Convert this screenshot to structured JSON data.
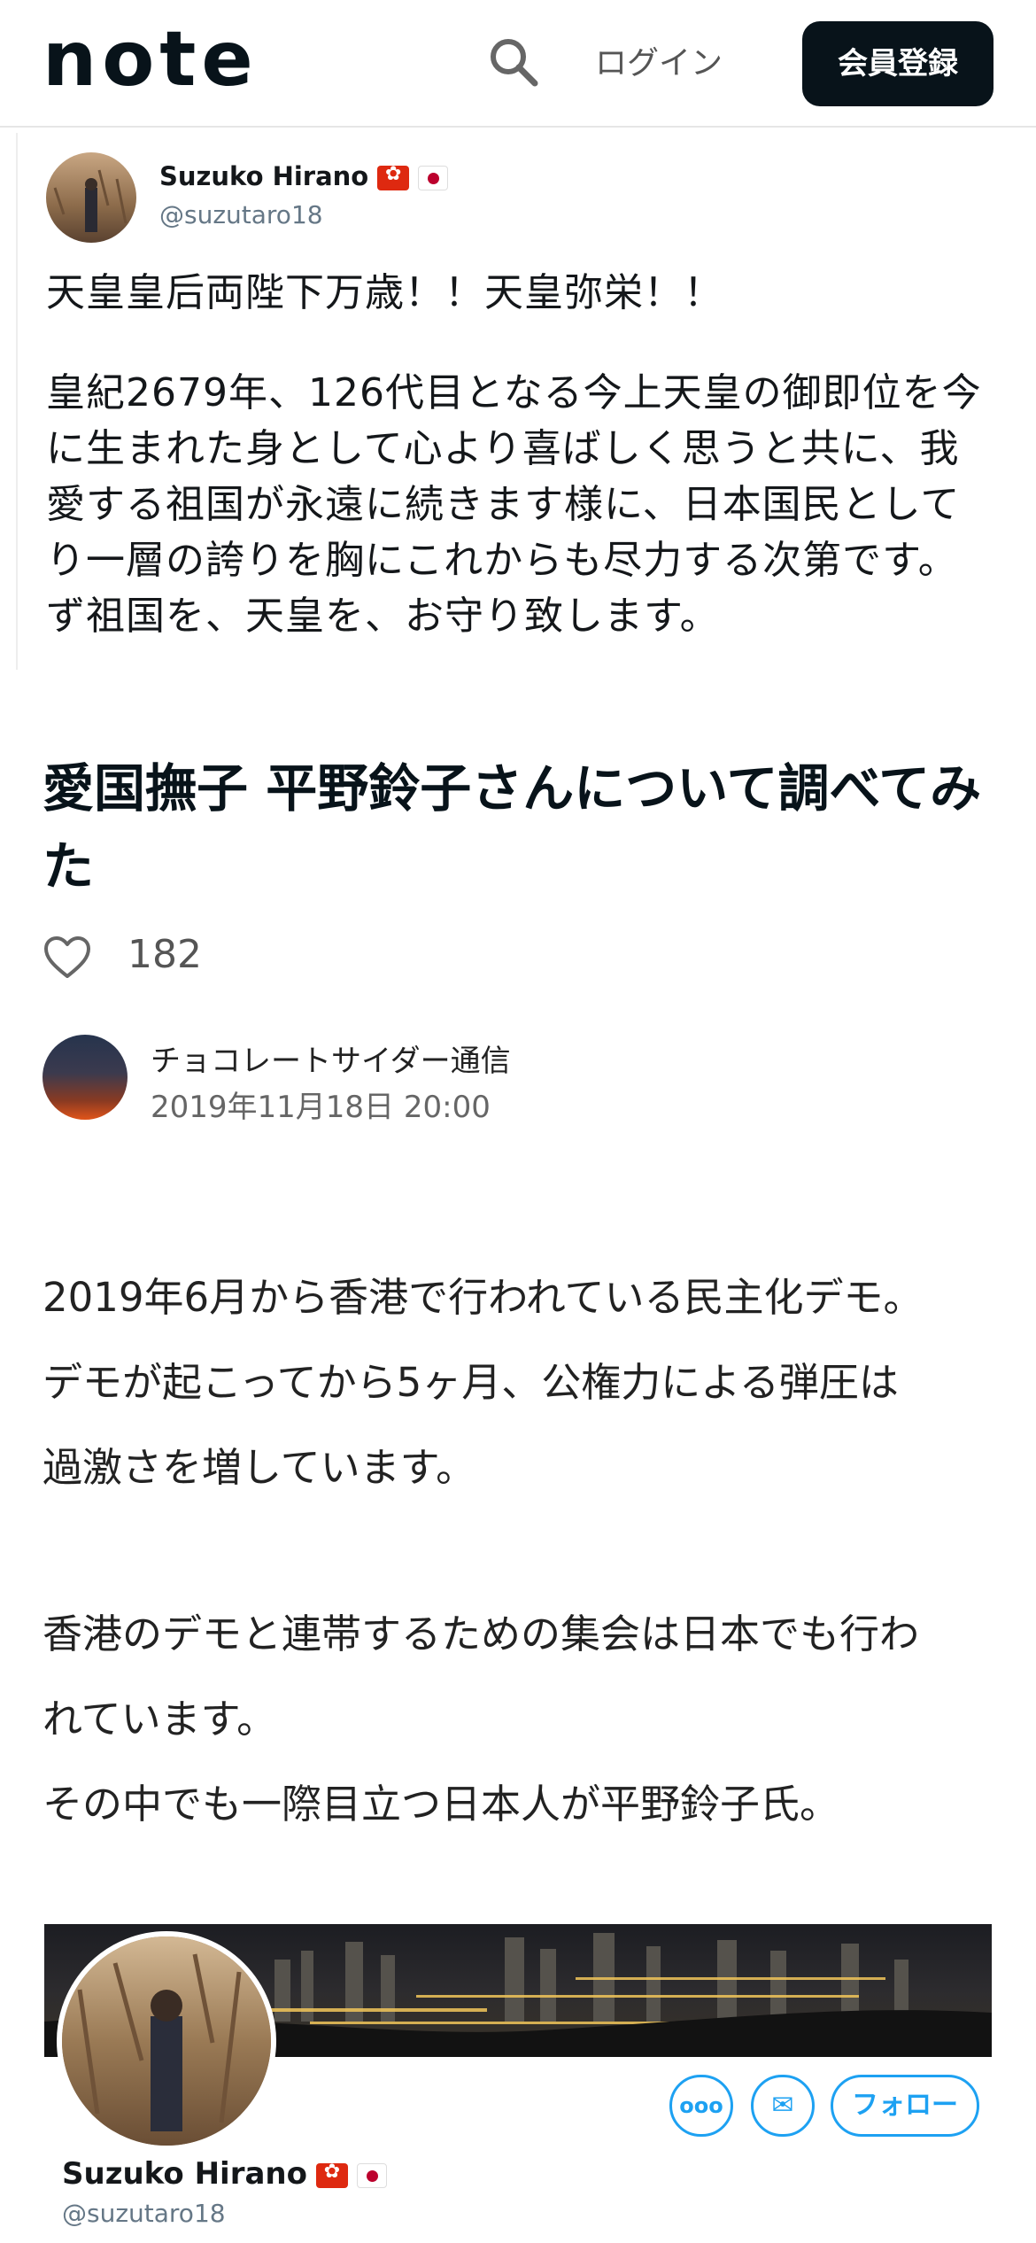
{
  "header": {
    "logo_text": "note",
    "login_label": "ログイン",
    "signup_label": "会員登録"
  },
  "tweet": {
    "name": "Suzuko Hirano",
    "handle": "@suzutaro18",
    "line1": "天皇皇后両陛下万歳！！天皇弥栄！！",
    "body": "皇紀2679年、126代目となる今上天皇の御即位を今\nに生まれた身として心より喜ばしく思うと共に、我\n愛する祖国が永遠に続きます様に、日本国民として\nり一層の誇りを胸にこれからも尽力する次第です。\nず祖国を、天皇を、お守り致します。"
  },
  "article": {
    "title": "愛国撫子 平野鈴子さんについて調べてみた",
    "likes": "182",
    "author": "チョコレートサイダー通信",
    "date": "2019年11月18日 20:00",
    "paragraphs": [
      "2019年6月から香港で行われている民主化デモ。",
      "デモが起こってから5ヶ月、公権力による弾圧は",
      "過激さを増しています。",
      "香港のデモと連帯するための集会は日本でも行わ",
      "れています。",
      "その中でも一際目立つ日本人が平野鈴子氏。"
    ]
  },
  "profile": {
    "name": "Suzuko Hirano",
    "handle": "@suzutaro18",
    "more_label": "ooo",
    "mail_label": "✉",
    "follow_label": "フォロー"
  },
  "colors": {
    "signup_bg": "#08131a",
    "twitter_blue": "#1da1f2",
    "text": "#222222"
  }
}
